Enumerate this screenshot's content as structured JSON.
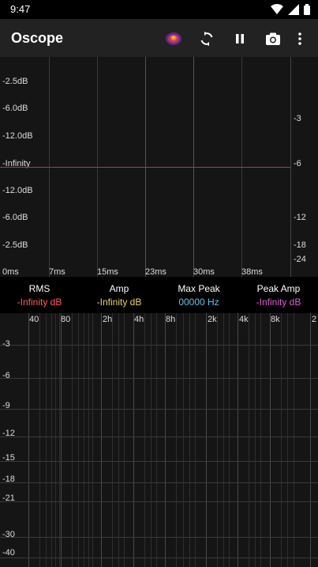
{
  "status": {
    "time": "9:47"
  },
  "app": {
    "title": "Oscope"
  },
  "scope": {
    "db_labels": [
      "-2.5dB",
      "-6.0dB",
      "-12.0dB",
      "-Infinity",
      "-12.0dB",
      "-6.0dB",
      "-2.5dB"
    ],
    "time_labels": [
      "0ms",
      "7ms",
      "15ms",
      "23ms",
      "30ms",
      "38ms"
    ],
    "side_labels": [
      "-3",
      "-6",
      "-12",
      "-18",
      "-24"
    ]
  },
  "meters": {
    "rms": {
      "label": "RMS",
      "value": "-Infinity dB",
      "color": "#ff5a5a"
    },
    "amp": {
      "label": "Amp",
      "value": "-Infinity dB",
      "color": "#e6d36a"
    },
    "max_peak": {
      "label": "Max Peak",
      "value": "00000 Hz",
      "color": "#5fc4e8"
    },
    "peak_amp": {
      "label": "Peak Amp",
      "value": "-Infinity dB",
      "color": "#e05ad6"
    }
  },
  "spectrum": {
    "freq_labels": [
      "40",
      "80",
      "2h",
      "4h",
      "8h",
      "2k",
      "4k",
      "8k",
      "2"
    ],
    "db_labels": [
      "-3",
      "-6",
      "-9",
      "-12",
      "-15",
      "-18",
      "-21",
      "-30",
      "-40"
    ]
  }
}
